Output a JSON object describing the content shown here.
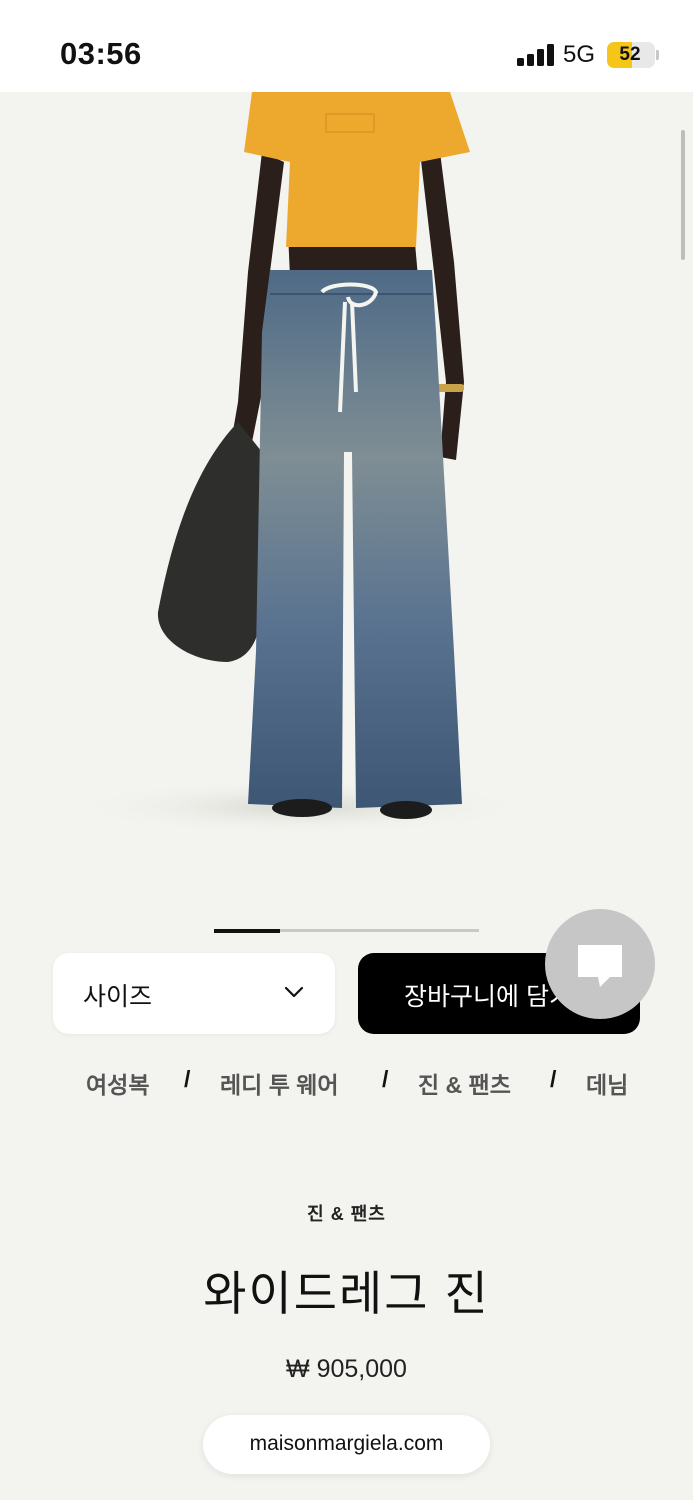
{
  "status_bar": {
    "time": "03:56",
    "network": "5G",
    "battery_level": "52",
    "battery_fraction": 0.52,
    "battery_color": "#f5c518"
  },
  "product_image": {
    "alt": "Model wearing wide-leg jeans with yellow crop top holding black bag",
    "carousel_progress_fraction": 0.25
  },
  "size_select": {
    "label": "사이즈",
    "icon": "chevron-down-icon"
  },
  "cart_button": {
    "label": "장바구니에 담기"
  },
  "chat_button": {
    "icon": "chat-bubble-icon"
  },
  "breadcrumb": {
    "items": [
      "여성복",
      "레디 투 웨어",
      "진 & 팬츠",
      "데님"
    ],
    "separator": "/"
  },
  "product": {
    "category": "진 & 팬츠",
    "title": "와이드레그 진",
    "price": "₩ 905,000"
  },
  "browser": {
    "url": "maisonmargiela.com"
  }
}
